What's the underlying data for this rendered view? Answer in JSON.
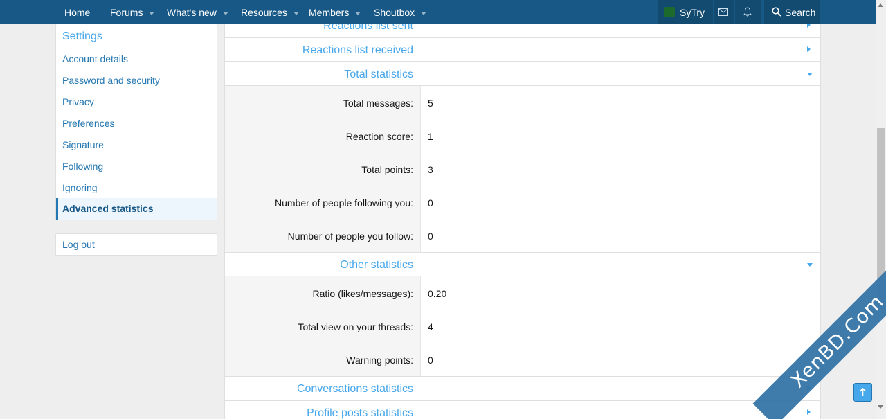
{
  "nav": {
    "items": [
      {
        "label": "Home",
        "has_menu": false
      },
      {
        "label": "Forums",
        "has_menu": true
      },
      {
        "label": "What's new",
        "has_menu": true
      },
      {
        "label": "Resources",
        "has_menu": true
      },
      {
        "label": "Members",
        "has_menu": true
      },
      {
        "label": "Shoutbox",
        "has_menu": true
      }
    ],
    "user": "SyTry",
    "search": "Search"
  },
  "sidebar": {
    "title": "Settings",
    "items": [
      {
        "label": "Account details"
      },
      {
        "label": "Password and security"
      },
      {
        "label": "Privacy"
      },
      {
        "label": "Preferences"
      },
      {
        "label": "Signature"
      },
      {
        "label": "Following"
      },
      {
        "label": "Ignoring"
      },
      {
        "label": "Advanced statistics",
        "active": true
      }
    ],
    "logout": "Log out"
  },
  "sections": {
    "reactions_sent": "Reactions list sent",
    "reactions_received": "Reactions list received",
    "total": {
      "title": "Total statistics",
      "rows": [
        {
          "label": "Total messages:",
          "value": "5"
        },
        {
          "label": "Reaction score:",
          "value": "1"
        },
        {
          "label": "Total points:",
          "value": "3"
        },
        {
          "label": "Number of people following you:",
          "value": "0"
        },
        {
          "label": "Number of people you follow:",
          "value": "0"
        }
      ]
    },
    "other": {
      "title": "Other statistics",
      "rows": [
        {
          "label": "Ratio (likes/messages):",
          "value": "0.20"
        },
        {
          "label": "Total view on your threads:",
          "value": "4"
        },
        {
          "label": "Warning points:",
          "value": "0"
        }
      ]
    },
    "conversations": "Conversations statistics",
    "profile_posts": "Profile posts statistics"
  },
  "watermark": "XenBD.Com",
  "colors": {
    "nav": "#185886",
    "link": "#2577b1",
    "accent": "#47a7eb"
  }
}
